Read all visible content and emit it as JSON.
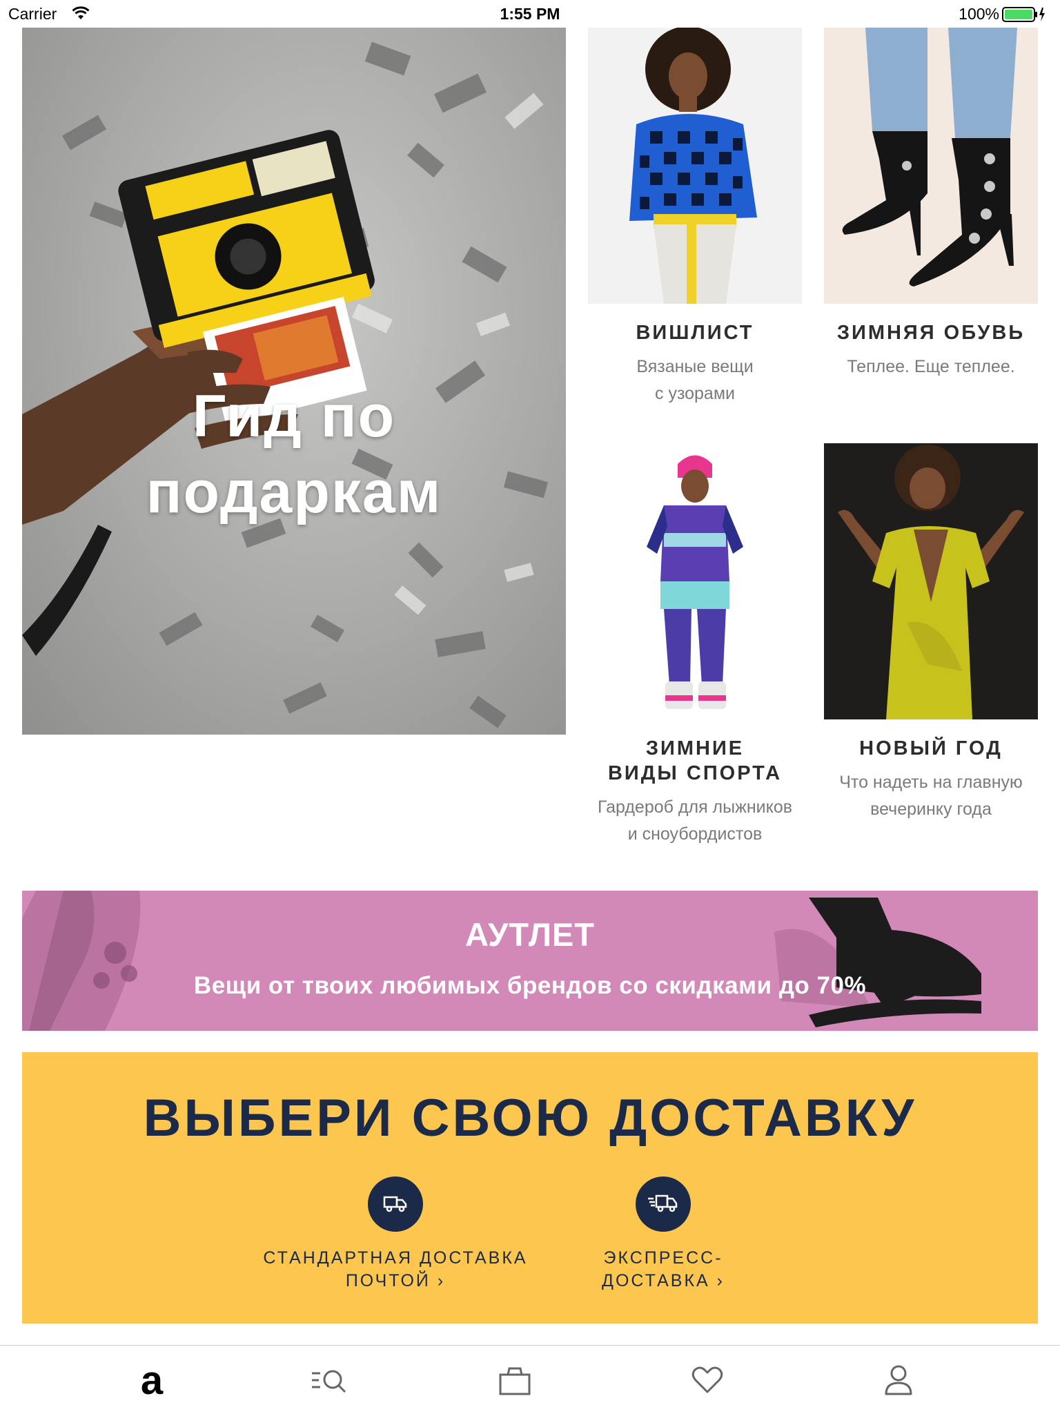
{
  "status_bar": {
    "carrier": "Carrier",
    "time": "1:55 PM",
    "battery": "100%"
  },
  "hero": {
    "title_line1": "Гид по",
    "title_line2": "подаркам"
  },
  "categories": [
    {
      "title": "ВИШЛИСТ",
      "subtitle_line1": "Вязаные вещи",
      "subtitle_line2": "с узорами"
    },
    {
      "title": "ЗИМНЯЯ ОБУВЬ",
      "subtitle_line1": "Теплее. Еще теплее.",
      "subtitle_line2": ""
    },
    {
      "title_line1": "ЗИМНИЕ",
      "title_line2": "ВИДЫ СПОРТА",
      "subtitle_line1": "Гардероб для лыжников",
      "subtitle_line2": "и сноубордистов"
    },
    {
      "title": "НОВЫЙ ГОД",
      "subtitle_line1": "Что надеть на главную",
      "subtitle_line2": "вечеринку года"
    }
  ],
  "outlet": {
    "title": "АУТЛЕТ",
    "subtitle": "Вещи от твоих любимых брендов со скидками до 70%"
  },
  "delivery": {
    "title": "ВЫБЕРИ СВОЮ ДОСТАВКУ",
    "standard": {
      "line1": "СТАНДАРТНАЯ ДОСТАВКА",
      "line2": "ПОЧТОЙ ›"
    },
    "express": {
      "line1": "ЭКСПРЕСС-",
      "line2": "ДОСТАВКА ›"
    }
  },
  "tab_bar": {
    "icons": [
      "home-logo-icon",
      "search-categories-icon",
      "bag-icon",
      "heart-icon",
      "profile-icon"
    ],
    "home_logo": "a"
  },
  "colors": {
    "outlet_bg": "#d389b8",
    "delivery_bg": "#fcc64f",
    "navy": "#1c2a4a",
    "battery_green": "#4cd964"
  }
}
